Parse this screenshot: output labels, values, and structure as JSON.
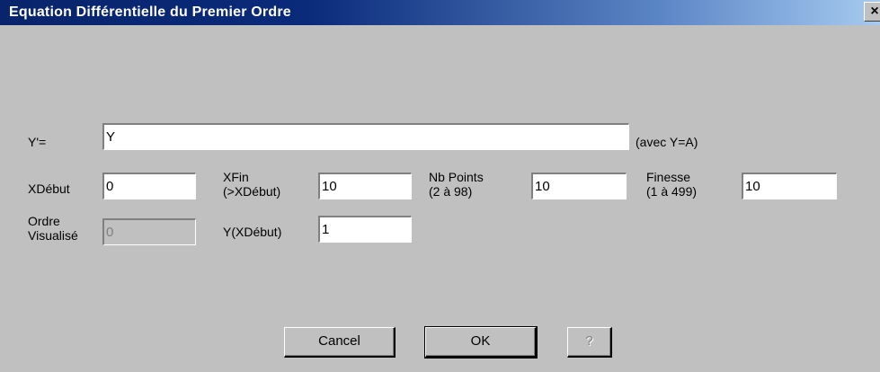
{
  "window": {
    "title": "Equation Différentielle du Premier Ordre",
    "close_glyph": "×"
  },
  "form": {
    "equation": {
      "label": "Y'=",
      "value": "Y",
      "hint": "(avec Y=A)"
    },
    "xdebut": {
      "label": "XDébut",
      "value": "0"
    },
    "xfin": {
      "label_line1": "XFin",
      "label_line2": "(>XDébut)",
      "value": "10"
    },
    "nb_points": {
      "label_line1": "Nb Points",
      "label_line2": "(2 à 98)",
      "value": "10"
    },
    "finesse": {
      "label_line1": "Finesse",
      "label_line2": "(1 à 499)",
      "value": "10"
    },
    "ordre": {
      "label_line1": "Ordre",
      "label_line2": "Visualisé",
      "value": "0"
    },
    "y_xdebut": {
      "label": "Y(XDébut)",
      "value": "1"
    }
  },
  "buttons": {
    "cancel": "Cancel",
    "ok": "OK",
    "help": "?"
  }
}
